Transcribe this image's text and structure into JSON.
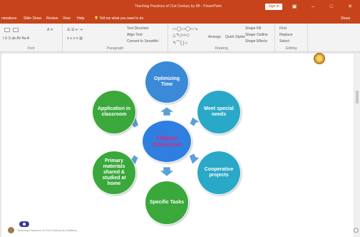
{
  "window": {
    "title": "Teaching Practices of 21st Century by IIB - PowerPoint",
    "signin": "Sign in",
    "controls": [
      "▣",
      "–",
      "□",
      "✕"
    ]
  },
  "tabs": [
    "nimations",
    "Slide Show",
    "Review",
    "View",
    "Help"
  ],
  "tell_me": "💡 Tell me what you want to do",
  "share": "Share",
  "ribbon": {
    "groups": [
      {
        "label": "Font"
      },
      {
        "label": "Paragraph"
      },
      {
        "label": "Drawing"
      },
      {
        "label": "Editing"
      }
    ],
    "paragraph_items": [
      "Text Direction",
      "Align Text",
      "Convert to SmartArt"
    ],
    "drawing_items": [
      "Arrange",
      "Quick Styles",
      "Shape Fill",
      "Shape Outline",
      "Shape Effects"
    ],
    "editing_items": [
      "Find",
      "Replace",
      "Select"
    ]
  },
  "diagram": {
    "center": {
      "label": "Flipped Classroom",
      "color": "#2f7fe0",
      "text_color": "#e8207a"
    },
    "nodes": [
      {
        "id": "optimizing",
        "label": "Optimizing Time",
        "color": "#3a8ad8"
      },
      {
        "id": "meet",
        "label": "Meet special needs",
        "color": "#2aa8c8"
      },
      {
        "id": "cooperative",
        "label": "Cooperative projects",
        "color": "#2aa8c8"
      },
      {
        "id": "specific",
        "label": "Specific Tasks",
        "color": "#3aa83a"
      },
      {
        "id": "primary",
        "label": "Primary materials shared & studied at home",
        "color": "#3aa83a"
      },
      {
        "id": "application",
        "label": "Application in classroom",
        "color": "#3aa83a"
      }
    ]
  },
  "footer": {
    "text": "Teaching Practices of 21st Century by Mulberry..."
  }
}
